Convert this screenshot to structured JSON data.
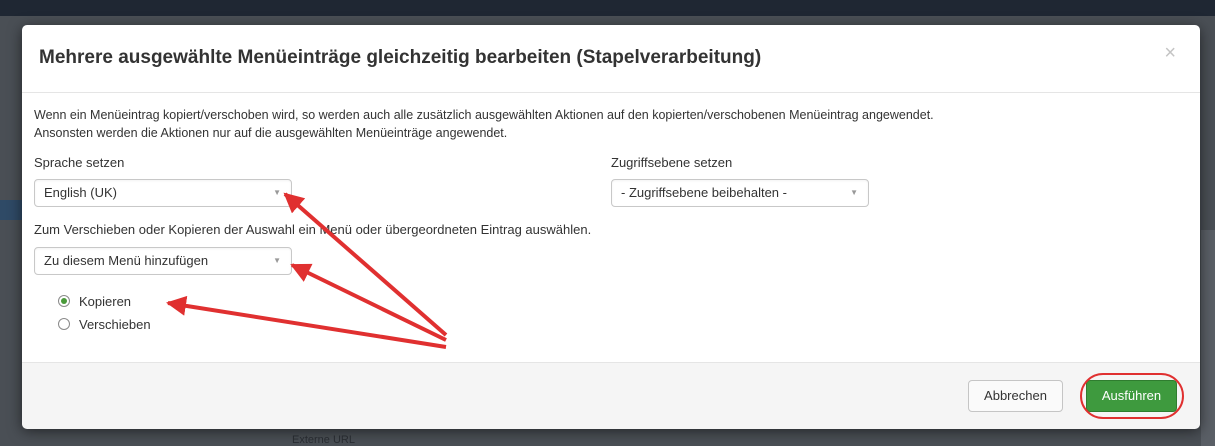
{
  "dialog": {
    "title": "Mehrere ausgewählte Menüeinträge gleichzeitig bearbeiten (Stapelverarbeitung)",
    "close_label": "×",
    "description_line1": "Wenn ein Menüeintrag kopiert/verschoben wird, so werden auch alle zusätzlich ausgewählten Aktionen auf den kopierten/verschobenen Menüeintrag angewendet.",
    "description_line2": "Ansonsten werden die Aktionen nur auf die ausgewählten Menüeinträge angewendet."
  },
  "language": {
    "label": "Sprache setzen",
    "value": "English (UK)"
  },
  "access": {
    "label": "Zugriffsebene setzen",
    "value": "- Zugriffsebene beibehalten -"
  },
  "move_copy": {
    "label": "Zum Verschieben oder Kopieren der Auswahl ein Menü oder übergeordneten Eintrag auswählen.",
    "value": "Zu diesem Menü hinzufügen",
    "options": [
      {
        "label": "Kopieren",
        "checked": true
      },
      {
        "label": "Verschieben",
        "checked": false
      }
    ]
  },
  "footer": {
    "cancel_label": "Abbrechen",
    "run_label": "Ausführen"
  },
  "background": {
    "partial_text": "Externe URL"
  },
  "colors": {
    "annotation": "#e03030",
    "primary_button": "#3e9a3e"
  },
  "icons": {
    "dropdown_caret": "▼",
    "close": "×"
  }
}
